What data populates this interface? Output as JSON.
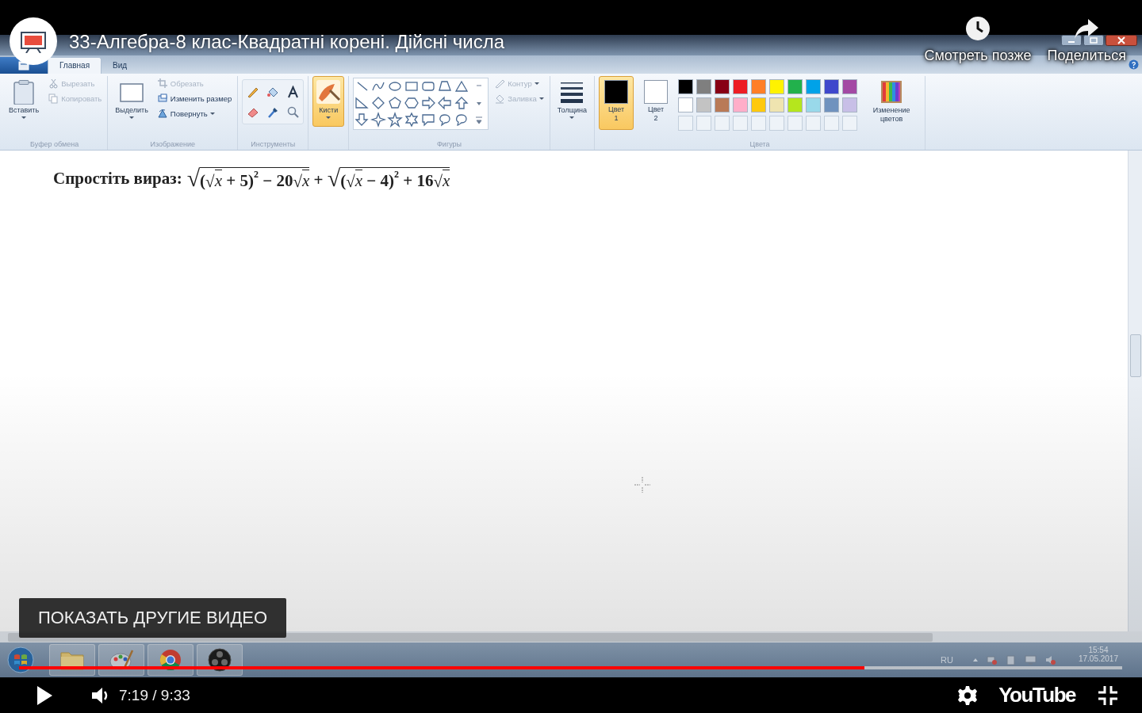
{
  "player": {
    "title": "33-Алгебра-8 клас-Квадратні корені. Дійсні числа",
    "actions": [
      {
        "kind": "watch_later",
        "label": "Смотреть позже"
      },
      {
        "kind": "share",
        "label": "Поделиться"
      }
    ],
    "more_videos": "ПОКАЗАТЬ ДРУГИЕ ВИДЕО",
    "progress": {
      "level": 0.766
    },
    "playing": false,
    "time": "7:19 / 9:33",
    "logo": "YouTube"
  },
  "paint": {
    "tabs": [
      {
        "label": "Главная",
        "selected": true
      },
      {
        "label": "Вид",
        "selected": false
      }
    ],
    "ribbon": [
      {
        "label": "Буфер обмена",
        "items": [
          {
            "kind": "large",
            "label": "Вставить",
            "dropdown": true,
            "selected": false
          },
          {
            "kind": "stack",
            "buttons": [
              {
                "label": "Вырезать",
                "disabled": true,
                "dropdown": false
              },
              {
                "label": "Копировать",
                "disabled": true,
                "dropdown": false
              }
            ]
          }
        ]
      },
      {
        "label": "Изображение",
        "items": [
          {
            "kind": "large",
            "label": "Выделить",
            "dropdown": true,
            "selected": false
          },
          {
            "kind": "stack",
            "buttons": [
              {
                "label": "Обрезать",
                "disabled": true,
                "dropdown": false
              },
              {
                "label": "Изменить размер",
                "disabled": false,
                "dropdown": false
              },
              {
                "label": "Повернуть",
                "disabled": false,
                "dropdown": true
              }
            ]
          }
        ]
      },
      {
        "label": "Инструменты",
        "items": [
          {
            "kind": "tools"
          }
        ]
      },
      {
        "items": [
          {
            "kind": "large",
            "label": "Кисти",
            "dropdown": true,
            "selected": true
          }
        ]
      },
      {
        "label": "Фигуры",
        "items": [
          {
            "kind": "shapes"
          },
          {
            "kind": "stack",
            "buttons": [
              {
                "label": "Контур",
                "disabled": true,
                "dropdown": true
              },
              {
                "label": "Заливка",
                "disabled": true,
                "dropdown": true
              }
            ]
          }
        ]
      },
      {
        "items": [
          {
            "kind": "large",
            "label": "Толщина",
            "dropdown": true,
            "selected": false
          }
        ]
      },
      {
        "label": "Цвета",
        "items": [
          {
            "kind": "color",
            "label": "Цвет 1",
            "color": "#000000",
            "selected": true
          },
          {
            "kind": "color",
            "label": "Цвет 2",
            "color": "#ffffff",
            "selected": false
          },
          {
            "kind": "palette",
            "colors": [
              {
                "color": "#000000"
              },
              {
                "color": "#7f7f7f"
              },
              {
                "color": "#880015"
              },
              {
                "color": "#ed1c24"
              },
              {
                "color": "#ff7f27"
              },
              {
                "color": "#fff200"
              },
              {
                "color": "#22b14c"
              },
              {
                "color": "#00a2e8"
              },
              {
                "color": "#3f48cc"
              },
              {
                "color": "#a349a4"
              },
              {
                "color": "#ffffff"
              },
              {
                "color": "#c3c3c3"
              },
              {
                "color": "#b97a57"
              },
              {
                "color": "#ffaec9"
              },
              {
                "color": "#ffc90e"
              },
              {
                "color": "#efe4b0"
              },
              {
                "color": "#b5e61d"
              },
              {
                "color": "#99d9ea"
              },
              {
                "color": "#7092be"
              },
              {
                "color": "#c8bfe7"
              }
            ]
          },
          {
            "kind": "large",
            "label": "Изменение цветов",
            "dropdown": false,
            "selected": false
          }
        ]
      }
    ],
    "canvas": {
      "prompt": "Спростіть вираз:",
      "expression": [
        {
          "kind": "sqrt",
          "sign": "√",
          "children": [
            {
              "kind": "text",
              "text": "("
            },
            {
              "kind": "sqrt",
              "sign": "√",
              "children": [
                {
                  "kind": "var",
                  "text": "x"
                }
              ]
            },
            {
              "kind": "text",
              "text": " + 5)"
            },
            {
              "kind": "sup",
              "text": "2"
            },
            {
              "kind": "text",
              "text": " − 20"
            },
            {
              "kind": "sqrt",
              "sign": "√",
              "children": [
                {
                  "kind": "var",
                  "text": "x"
                }
              ]
            }
          ]
        },
        {
          "kind": "text",
          "text": " + "
        },
        {
          "kind": "sqrt",
          "sign": "√",
          "children": [
            {
              "kind": "text",
              "text": "("
            },
            {
              "kind": "sqrt",
              "sign": "√",
              "children": [
                {
                  "kind": "var",
                  "text": "x"
                }
              ]
            },
            {
              "kind": "text",
              "text": " − 4)"
            },
            {
              "kind": "sup",
              "text": "2"
            },
            {
              "kind": "text",
              "text": " + 16"
            },
            {
              "kind": "sqrt",
              "sign": "√",
              "children": [
                {
                  "kind": "var",
                  "text": "x"
                }
              ]
            }
          ]
        }
      ]
    },
    "taskbar": {
      "language": "RU",
      "time": "15:54",
      "date": "17.05.2017"
    }
  }
}
